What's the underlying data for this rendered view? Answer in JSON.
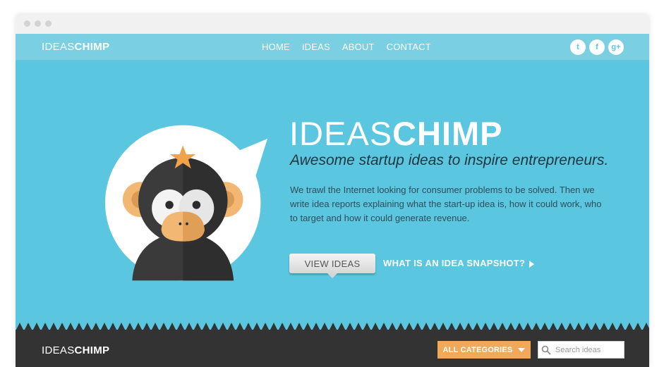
{
  "brand": {
    "thin": "IDEAS",
    "bold": "CHIMP"
  },
  "nav": {
    "items": [
      {
        "label": "HOME"
      },
      {
        "label": "IDEAS"
      },
      {
        "label": "ABOUT"
      },
      {
        "label": "CONTACT"
      }
    ]
  },
  "social": {
    "twitter": "t",
    "facebook": "f",
    "googleplus": "g+"
  },
  "hero": {
    "title_thin": "IDEAS",
    "title_bold": "CHIMP",
    "tagline": "Awesome startup ideas to inspire entrepreneurs.",
    "description": "We trawl the Internet looking for consumer problems to be solved. Then  we write idea reports explaining what the start-up idea is, how it could work, who to target and how it could generate revenue.",
    "view_button": "VIEW IDEAS",
    "snapshot_link": "WHAT IS AN IDEA SNAPSHOT?"
  },
  "footer": {
    "categories_button": "ALL CATEGORIES",
    "search_placeholder": "Search ideas"
  },
  "colors": {
    "hero_bg": "#5bc6df",
    "topbar_bg": "#7acfe2",
    "footer_bg": "#333333",
    "accent": "#f0a85a"
  },
  "icons": [
    "twitter-icon",
    "facebook-icon",
    "google-plus-icon",
    "chimp-mascot",
    "star-icon",
    "arrow-right-icon",
    "chevron-down-icon",
    "search-icon"
  ]
}
